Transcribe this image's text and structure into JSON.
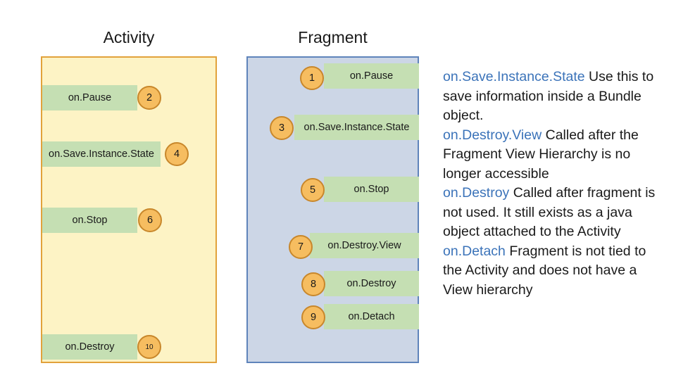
{
  "columns": {
    "activity_title": "Activity",
    "fragment_title": "Fragment"
  },
  "activity_steps": [
    {
      "label": "on.Pause",
      "number": "2"
    },
    {
      "label": "on.Save.Instance.State",
      "number": "4"
    },
    {
      "label": "on.Stop",
      "number": "6"
    },
    {
      "label": "on.Destroy",
      "number": "10"
    }
  ],
  "fragment_steps": [
    {
      "label": "on.Pause",
      "number": "1"
    },
    {
      "label": "on.Save.Instance.State",
      "number": "3"
    },
    {
      "label": "on.Stop",
      "number": "5"
    },
    {
      "label": "on.Destroy.View",
      "number": "7"
    },
    {
      "label": "on.Destroy",
      "number": "8"
    },
    {
      "label": "on.Detach",
      "number": "9"
    }
  ],
  "description": {
    "entries": [
      {
        "keyword": "on.Save.Instance.State",
        "text": "  Use this to save information inside a Bundle object."
      },
      {
        "keyword": "on.Destroy.View",
        "text": " Called after the Fragment View Hierarchy is no longer accessible"
      },
      {
        "keyword": "on.Destroy",
        "text": "  Called after fragment is not used. It still exists as a java object attached to the Activity"
      },
      {
        "keyword": "on.Detach",
        "text": "  Fragment is not tied to the Activity and does not have a View hierarchy"
      }
    ]
  },
  "colors": {
    "activity_panel_fill": "#fdf3c5",
    "activity_panel_border": "#e2a23b",
    "fragment_panel_fill": "#ccd6e6",
    "fragment_panel_border": "#5f84bb",
    "step_box_fill": "#c5dfb3",
    "circle_fill": "#f6bd60",
    "circle_border": "#c8872b",
    "keyword_color": "#3b73b9"
  }
}
